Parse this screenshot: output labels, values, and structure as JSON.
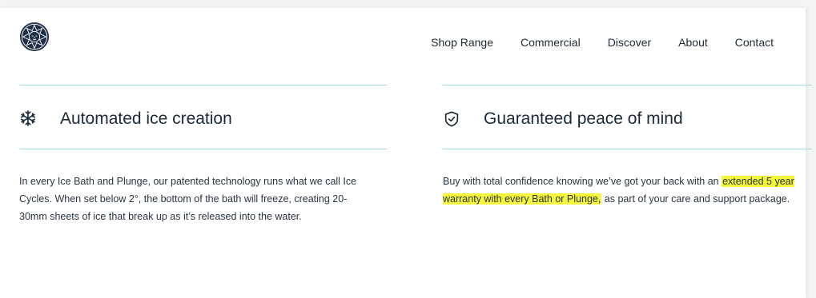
{
  "nav": {
    "items": [
      "Shop Range",
      "Commercial",
      "Discover",
      "About",
      "Contact"
    ]
  },
  "features": {
    "ice": {
      "title": "Automated ice creation",
      "text": "In every Ice Bath and Plunge, our patented technology runs what we call Ice Cycles. When set below 2°, the bottom of the bath will freeze, creating 20-30mm sheets of ice that break up as it’s released into the water."
    },
    "warranty": {
      "title": "Guaranteed peace of mind",
      "text_before": "Buy with total confidence knowing we’ve got your back with an ",
      "text_highlight": "extended 5 year warranty with every Bath or Plunge,",
      "text_after": " as part of your care and support package."
    }
  },
  "colors": {
    "divider": "#a9dde6",
    "highlight": "#f5f53a",
    "text": "#1c2a38"
  },
  "icons": {
    "logo": "lion-emblem-logo",
    "ice": "snowflake-icon",
    "warranty": "shield-check-icon"
  }
}
